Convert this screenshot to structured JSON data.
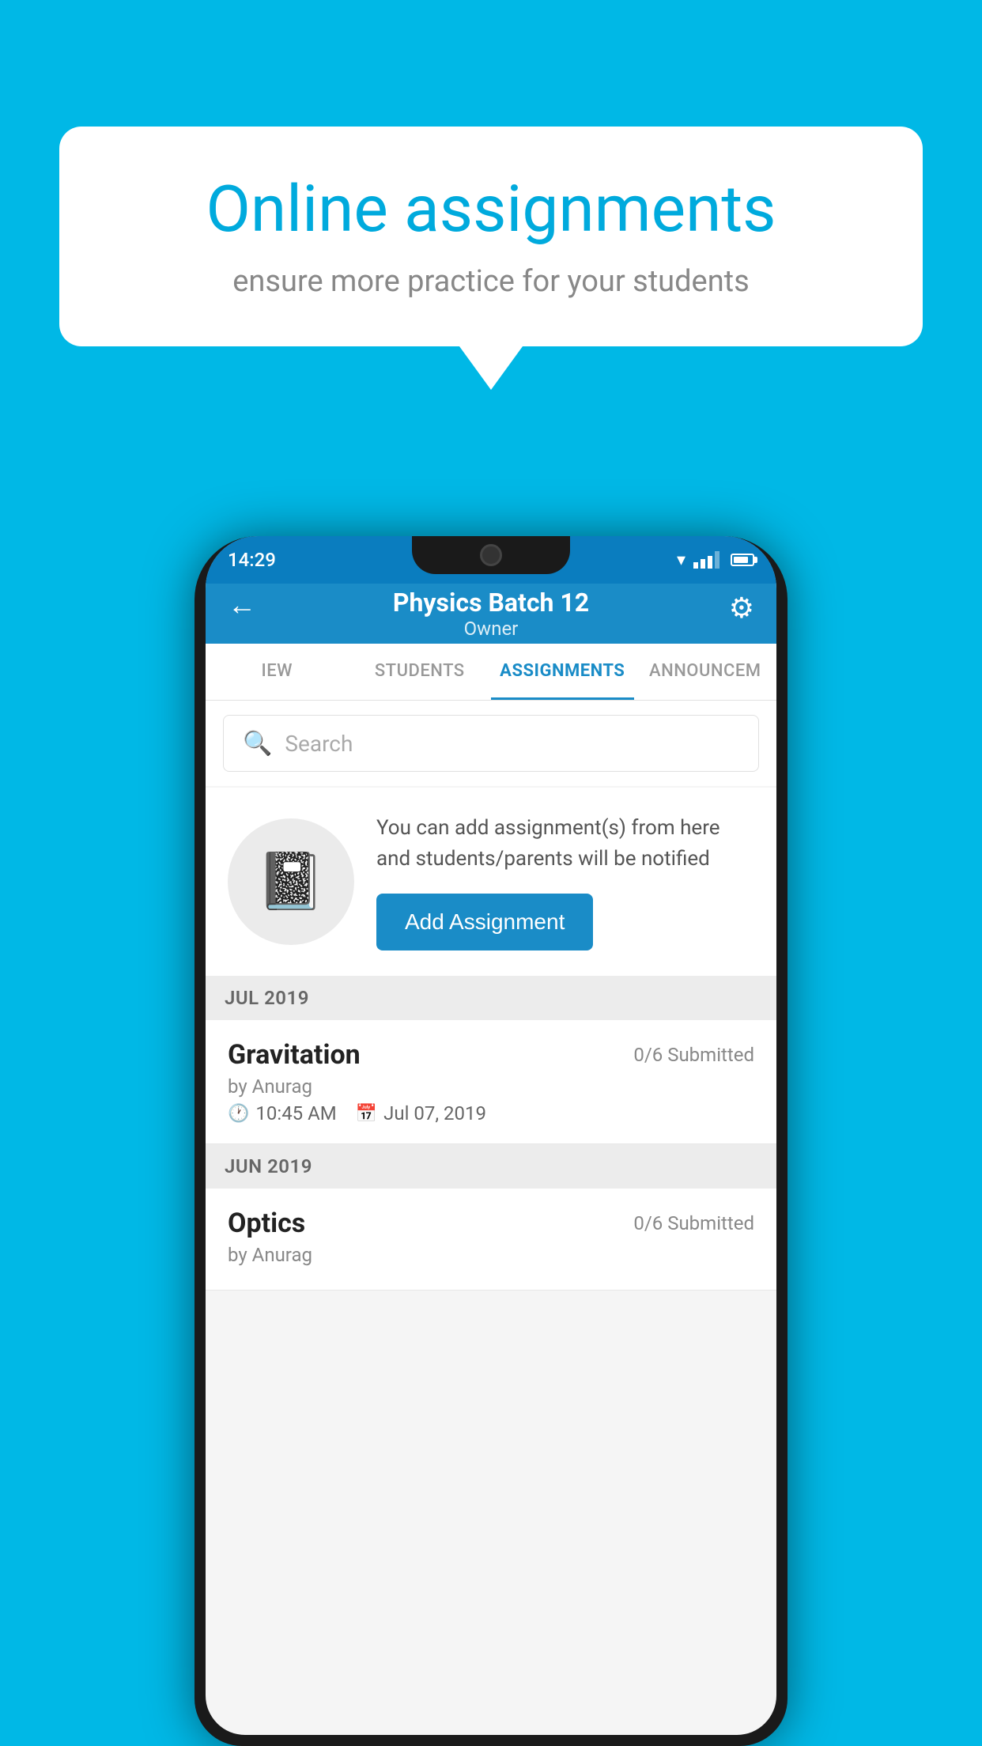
{
  "background_color": "#00b8e6",
  "speech_bubble": {
    "title": "Online assignments",
    "subtitle": "ensure more practice for your students"
  },
  "phone": {
    "status_bar": {
      "time": "14:29"
    },
    "header": {
      "title": "Physics Batch 12",
      "subtitle": "Owner",
      "back_label": "←",
      "settings_label": "⚙"
    },
    "tabs": [
      {
        "label": "IEW",
        "active": false
      },
      {
        "label": "STUDENTS",
        "active": false
      },
      {
        "label": "ASSIGNMENTS",
        "active": true
      },
      {
        "label": "ANNOUNCEM",
        "active": false
      }
    ],
    "search": {
      "placeholder": "Search"
    },
    "promo": {
      "description": "You can add assignment(s) from here and students/parents will be notified",
      "button_label": "Add Assignment"
    },
    "sections": [
      {
        "label": "JUL 2019",
        "assignments": [
          {
            "name": "Gravitation",
            "submitted": "0/6 Submitted",
            "by": "by Anurag",
            "time": "10:45 AM",
            "date": "Jul 07, 2019"
          }
        ]
      },
      {
        "label": "JUN 2019",
        "assignments": [
          {
            "name": "Optics",
            "submitted": "0/6 Submitted",
            "by": "by Anurag",
            "time": "",
            "date": ""
          }
        ]
      }
    ]
  }
}
